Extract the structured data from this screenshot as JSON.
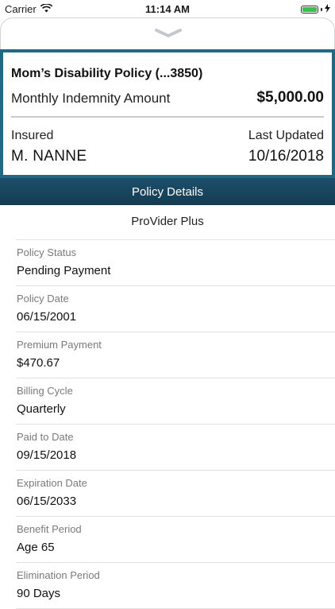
{
  "status_bar": {
    "carrier": "Carrier",
    "time": "11:14 AM",
    "battery_level": 1.0
  },
  "policy_card": {
    "title": "Mom’s Disability Policy (...3850)",
    "amount_label": "Monthly Indemnity Amount",
    "amount_value": "$5,000.00",
    "insured_label": "Insured",
    "insured_value": "M. NANNE",
    "updated_label": "Last Updated",
    "updated_value": "10/16/2018"
  },
  "section_title": "Policy Details",
  "product_name": "ProVider Plus",
  "details": [
    {
      "label": "Policy Status",
      "value": "Pending Payment"
    },
    {
      "label": "Policy Date",
      "value": "06/15/2001"
    },
    {
      "label": "Premium Payment",
      "value": "$470.67"
    },
    {
      "label": "Billing Cycle",
      "value": "Quarterly"
    },
    {
      "label": "Paid to Date",
      "value": "09/15/2018"
    },
    {
      "label": "Expiration Date",
      "value": "06/15/2033"
    },
    {
      "label": "Benefit Period",
      "value": "Age 65"
    },
    {
      "label": "Elimination Period",
      "value": "90 Days"
    }
  ],
  "colors": {
    "card_border": "#1e6a84",
    "header_bg": "#1c4f6a",
    "battery": "#37c24a"
  }
}
